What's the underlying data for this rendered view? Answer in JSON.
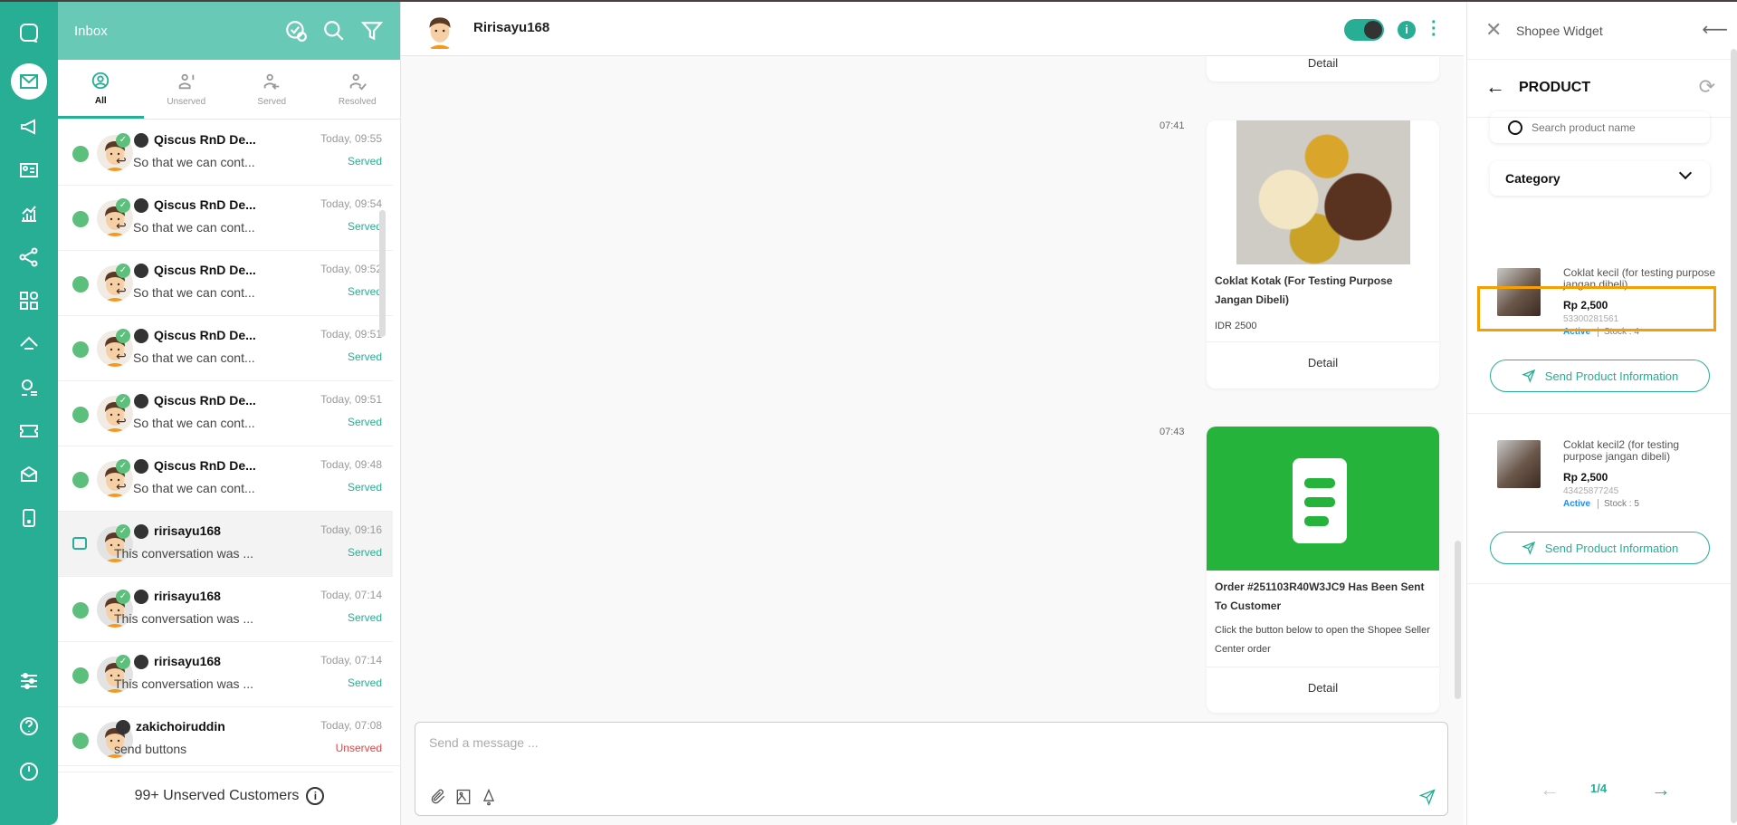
{
  "sidebar": {
    "items": [
      "logo",
      "inbox",
      "broadcast",
      "contacts",
      "analytics",
      "integrations",
      "apps",
      "campaign",
      "agents",
      "tickets",
      "archive",
      "mobile",
      "settings",
      "help",
      "logout"
    ],
    "accent": "#27ae94"
  },
  "inbox": {
    "title": "Inbox",
    "tabs": [
      {
        "label": "All"
      },
      {
        "label": "Unserved"
      },
      {
        "label": "Served"
      },
      {
        "label": "Resolved"
      }
    ],
    "rows": [
      {
        "name": "Qiscus RnD De...",
        "preview": "So that we can cont...",
        "time": "Today, 09:55",
        "status": "Served",
        "reply": true,
        "checked": true,
        "channel": "qiscus"
      },
      {
        "name": "Qiscus RnD De...",
        "preview": "So that we can cont...",
        "time": "Today, 09:54",
        "status": "Served",
        "reply": true,
        "checked": true,
        "channel": "qiscus"
      },
      {
        "name": "Qiscus RnD De...",
        "preview": "So that we can cont...",
        "time": "Today, 09:52",
        "status": "Served",
        "reply": true,
        "checked": true,
        "channel": "qiscus"
      },
      {
        "name": "Qiscus RnD De...",
        "preview": "So that we can cont...",
        "time": "Today, 09:51",
        "status": "Served",
        "reply": true,
        "checked": true,
        "channel": "qiscus"
      },
      {
        "name": "Qiscus RnD De...",
        "preview": "So that we can cont...",
        "time": "Today, 09:51",
        "status": "Served",
        "reply": true,
        "checked": true,
        "channel": "qiscus"
      },
      {
        "name": "Qiscus RnD De...",
        "preview": "So that we can cont...",
        "time": "Today, 09:48",
        "status": "Served",
        "reply": true,
        "checked": true,
        "channel": "qiscus"
      },
      {
        "name": "ririsayu168",
        "preview": "This conversation was ...",
        "time": "Today, 09:16",
        "status": "Served",
        "reply": false,
        "checked": true,
        "channel": "image",
        "selected": true
      },
      {
        "name": "ririsayu168",
        "preview": "This conversation was ...",
        "time": "Today, 07:14",
        "status": "Served",
        "reply": false,
        "checked": true,
        "channel": "hub"
      },
      {
        "name": "ririsayu168",
        "preview": "This conversation was ...",
        "time": "Today, 07:14",
        "status": "Served",
        "reply": false,
        "checked": true,
        "channel": "hub"
      },
      {
        "name": "zakichoiruddin",
        "preview": "send buttons",
        "time": "Today, 07:08",
        "status": "Unserved",
        "reply": false,
        "checked": false,
        "channel": "hub"
      }
    ],
    "footer": "99+ Unserved Customers"
  },
  "chat": {
    "contact": "Ririsayu168",
    "cards": [
      {
        "detail": "Detail"
      },
      {
        "time": "07:41",
        "title": "Coklat Kotak (For Testing Purpose Jangan Dibeli)",
        "desc": "IDR 2500",
        "detail": "Detail"
      },
      {
        "time": "07:43",
        "title": "Order #251103R40W3JC9 Has Been Sent To Customer",
        "desc": "Click the button below to open the Shopee Seller Center order",
        "detail": "Detail"
      }
    ],
    "composer_placeholder": "Send a message ..."
  },
  "widget": {
    "title": "Shopee Widget",
    "section": "PRODUCT",
    "search_placeholder": "Search product name",
    "category": "Category",
    "products": [
      {
        "name": "Coklat kecil (for testing purpose jangan dibeli)",
        "price": "Rp 2,500",
        "sku": "53300281561",
        "status": "Active",
        "stock": "Stock : 4",
        "button": "Send Product Information"
      },
      {
        "name": "Coklat kecil2 (for testing purpose jangan dibeli)",
        "price": "Rp 2,500",
        "sku": "43425877245",
        "status": "Active",
        "stock": "Stock : 5",
        "button": "Send Product Information"
      }
    ],
    "page": "1/4",
    "highlight": "#f5a000"
  }
}
